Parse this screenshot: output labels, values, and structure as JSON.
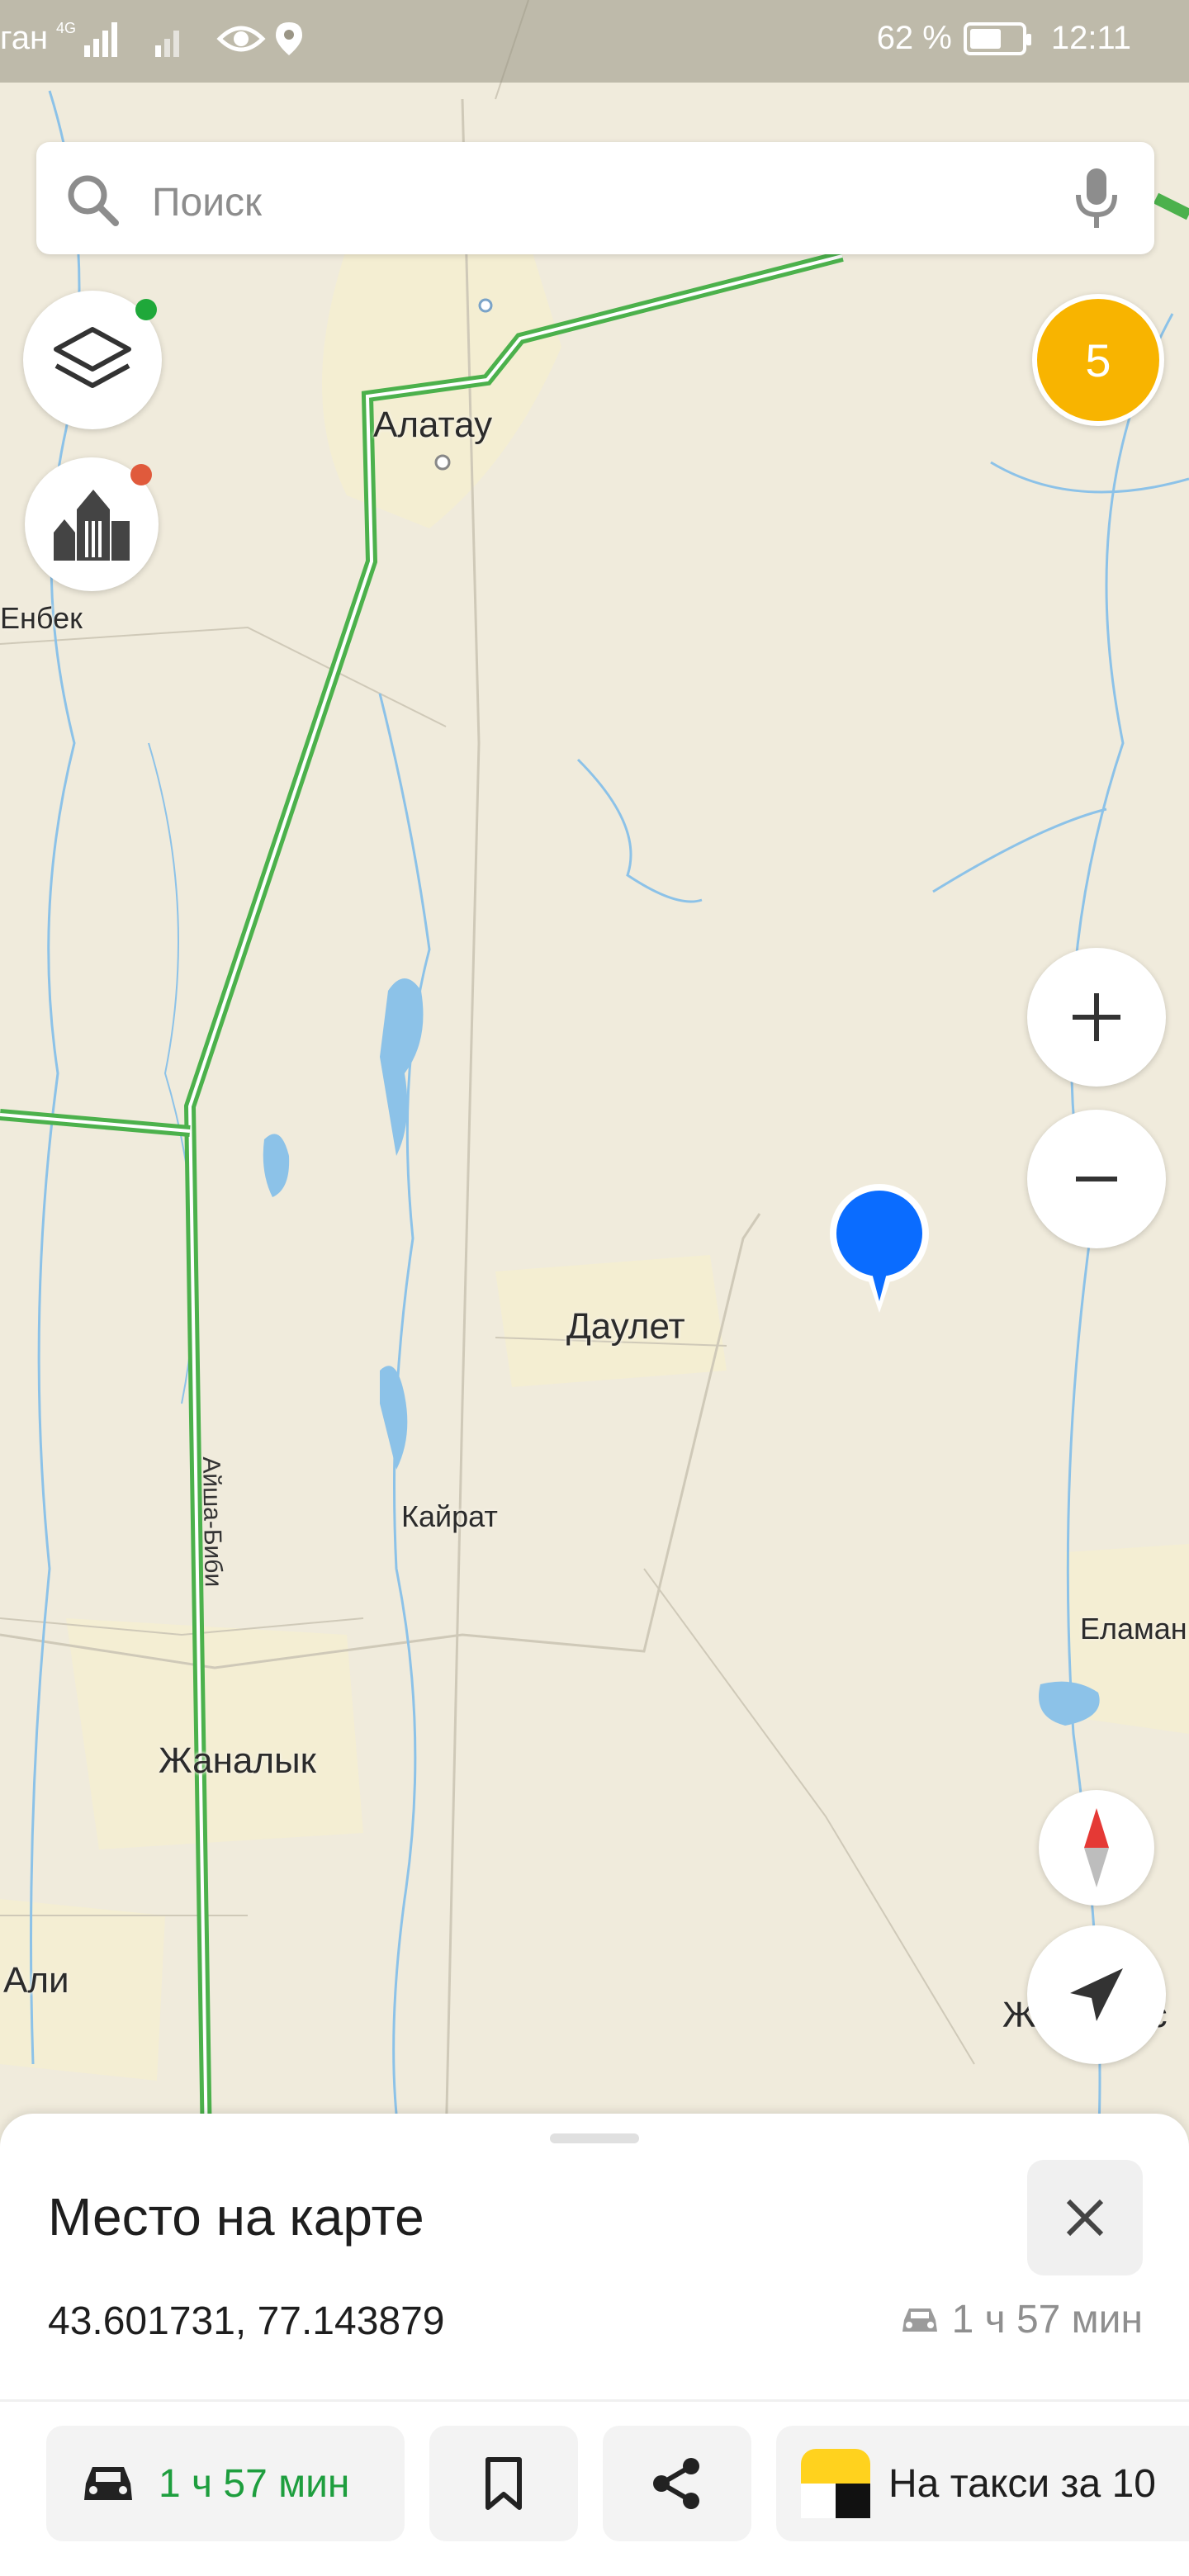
{
  "status_bar": {
    "carrier": "ган",
    "network": "4G",
    "battery_text": "62 %",
    "battery_level": 0.62,
    "time": "12:11"
  },
  "search": {
    "placeholder": "Поиск",
    "icon": "search-icon",
    "voice_icon": "microphone-icon"
  },
  "map_controls": {
    "layers_icon": "layers-icon",
    "layers_dot_color": "#1fa83a",
    "places_icon": "buildings-icon",
    "places_dot_color": "#e05a3c",
    "traffic_level": "5",
    "traffic_color": "#f8b400",
    "zoom_in_icon": "plus-icon",
    "zoom_out_icon": "minus-icon",
    "compass_icon": "compass-icon",
    "locate_icon": "location-arrow-icon"
  },
  "map": {
    "pin_color": "#0a6cff",
    "road_color": "#4cb14c",
    "labels": {
      "alatau": "Алатау",
      "enbek": "Енбек",
      "daulet": "Даулет",
      "kairat": "Кайрат",
      "elaman": "Еламан",
      "zhanalyk": "Жаналык",
      "ali": "Али",
      "zhalamys": "Жаламыс",
      "road": "Айша-Биби"
    }
  },
  "sheet": {
    "title": "Место на карте",
    "coordinates": "43.601731, 77.143879",
    "eta": "1 ч 57 мин",
    "close_icon": "close-icon"
  },
  "actions": {
    "route_eta": "1 ч 57 мин",
    "route_color": "#1e9e3e",
    "route_icon": "car-icon",
    "bookmark_icon": "bookmark-icon",
    "share_icon": "share-icon",
    "taxi_label": "На такси за 10",
    "taxi_icon": "yandex-taxi-icon"
  }
}
